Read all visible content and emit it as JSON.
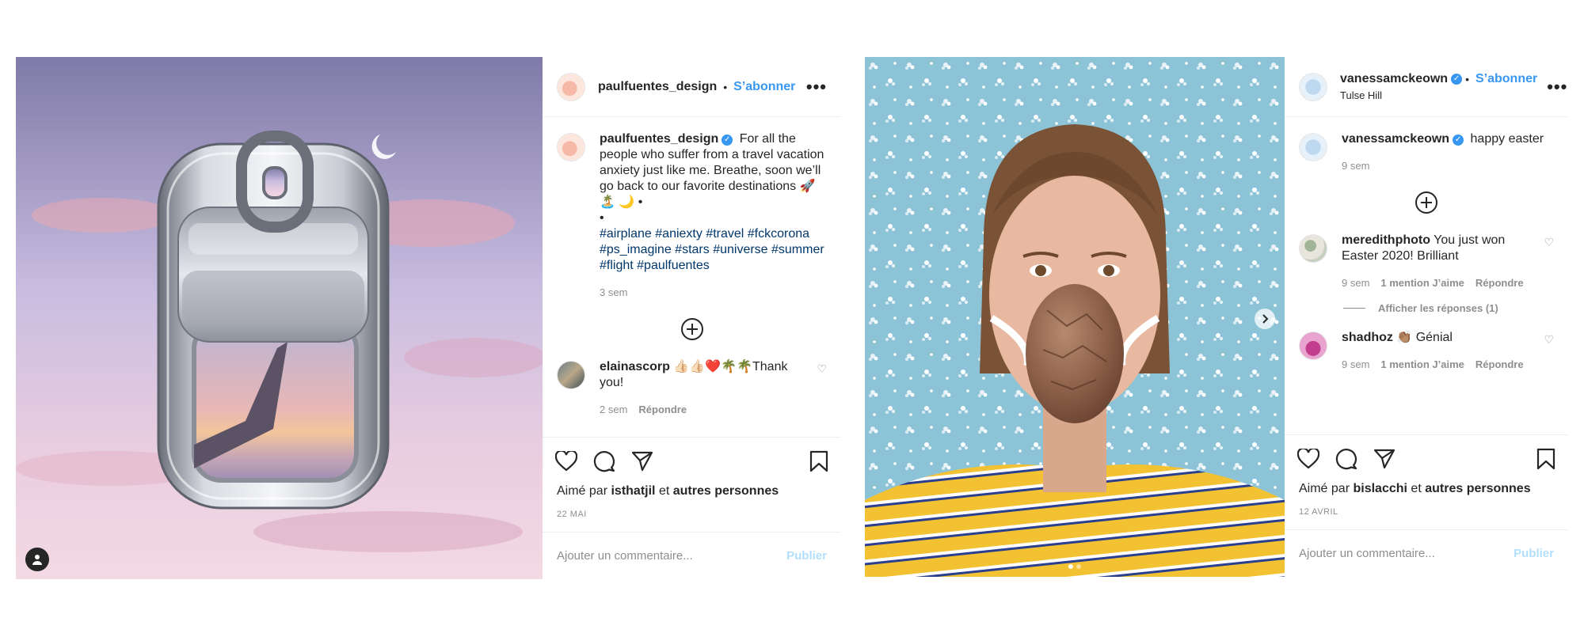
{
  "post1": {
    "header": {
      "username": "paulfuentes_design",
      "separator": "•",
      "follow_label": "S’abonner",
      "more_label": "•••"
    },
    "caption": {
      "username": "paulfuentes_design",
      "text": "For all the people who suffer from a travel vacation anxiety just like me. Breathe, soon we’ll go back to our favorite destinations 🚀 🏝️ 🌙 •",
      "bullet": "•",
      "hashtags": "#airplane #aniexty #travel #fckcorona #ps_imagine #stars #universe #summer #flight #paulfuentes",
      "time": "3 sem"
    },
    "comment": {
      "username": "elainascorp",
      "text": "👍🏻👍🏻❤️🌴🌴Thank you!",
      "time": "2 sem",
      "reply_label": "Répondre"
    },
    "likes": {
      "prefix": "Aimé par",
      "user": "isthatjil",
      "conj": "et",
      "others": "autres personnes"
    },
    "date": "22 MAI",
    "add_comment": {
      "placeholder": "Ajouter un commentaire...",
      "publish_label": "Publier"
    }
  },
  "post2": {
    "header": {
      "username": "vanessamckeown",
      "separator": "•",
      "follow_label": "S’abonner",
      "location": "Tulse Hill",
      "more_label": "•••"
    },
    "caption": {
      "username": "vanessamckeown",
      "text": "happy easter",
      "time": "9 sem"
    },
    "comments": [
      {
        "username": "meredithphoto",
        "text": "You just won Easter 2020! Brilliant",
        "time": "9 sem",
        "likes": "1 mention J’aime",
        "reply_label": "Répondre"
      },
      {
        "username": "shadhoz",
        "text": "👏🏽 Génial",
        "time": "9 sem",
        "likes": "1 mention J’aime",
        "reply_label": "Répondre"
      }
    ],
    "view_replies": "Afficher les réponses (1)",
    "likes": {
      "prefix": "Aimé par",
      "user": "bislacchi",
      "conj": "et",
      "others": "autres personnes"
    },
    "date": "12 AVRIL",
    "add_comment": {
      "placeholder": "Ajouter un commentaire...",
      "publish_label": "Publier"
    }
  },
  "colors": {
    "link_blue": "#3897f0",
    "hashtag": "#00376b",
    "muted": "#8e8e8e",
    "publish_disabled": "#b2dffc"
  }
}
